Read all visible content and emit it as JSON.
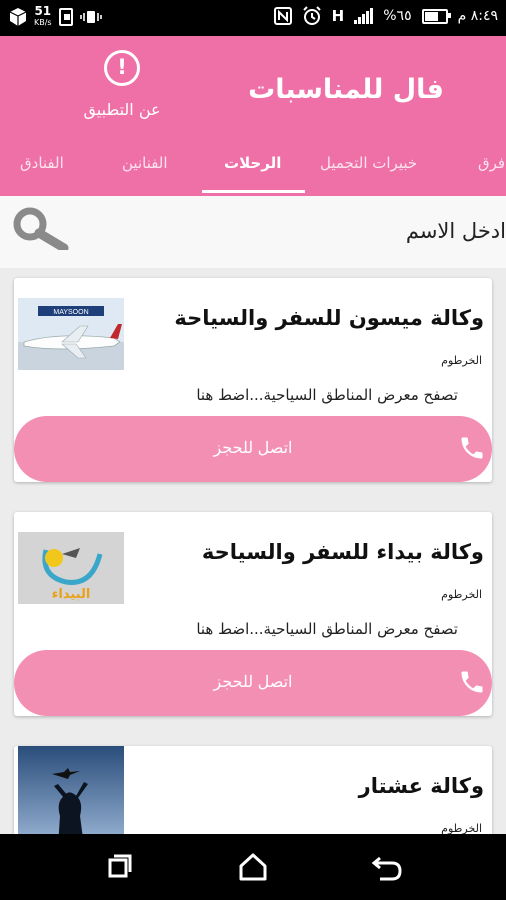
{
  "status_bar": {
    "time": "٨:٤٩ م",
    "battery_percent": "%٦٥",
    "network_h": "H",
    "network_speed": "51",
    "network_speed_unit": "KB/s"
  },
  "app_bar": {
    "title": "فال للمناسبات",
    "about_label": "عن التطبيق",
    "about_icon": "!",
    "background_color": "#ef6fa7"
  },
  "tabs": [
    {
      "label": "الفنادق",
      "active": false
    },
    {
      "label": "الفنانين",
      "active": false
    },
    {
      "label": "الرحلات",
      "active": true
    },
    {
      "label": "خبيرات التجميل",
      "active": false
    },
    {
      "label": "فرق",
      "active": false
    }
  ],
  "search": {
    "placeholder": "ادخل الاسم"
  },
  "cards": [
    {
      "name": "وكالة ميسون للسفر والسياحة",
      "city": "الخرطوم",
      "browse": "تصفح معرض المناطق السياحية...اضط هنا",
      "call_label": "اتصل للحجز",
      "thumb": "airplane",
      "thumb_caption": "MAYSOON"
    },
    {
      "name": "وكالة بيداء للسفر والسياحة",
      "city": "الخرطوم",
      "browse": "تصفح معرض المناطق السياحية...اضط هنا",
      "call_label": "اتصل للحجز",
      "thumb": "baidaa-logo",
      "thumb_caption": "البيداء"
    },
    {
      "name": "وكالة عشتار",
      "city": "الخرطوم",
      "browse": "",
      "call_label": "",
      "thumb": "silhouette"
    }
  ],
  "colors": {
    "accent": "#ef6fa7",
    "button": "#f48fb4"
  }
}
